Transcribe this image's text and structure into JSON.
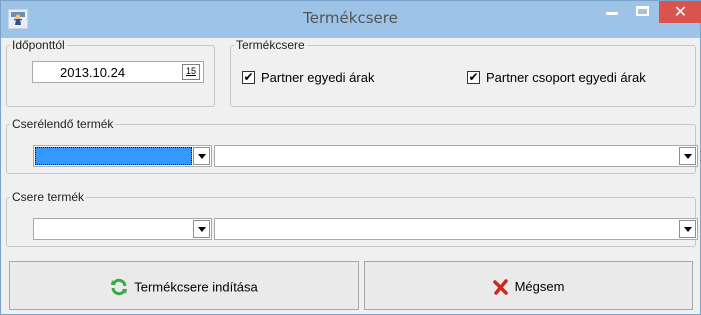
{
  "window": {
    "title": "Termékcsere"
  },
  "date_group": {
    "label": "Időponttól",
    "value": "2013.10.24",
    "calendar_glyph": "15"
  },
  "exchange_group": {
    "label": "Termékcsere",
    "partner_prices": {
      "label": "Partner egyedi árak",
      "checked": true
    },
    "partner_group_prices": {
      "label": "Partner csoport egyedi árak",
      "checked": true
    }
  },
  "source_product": {
    "label": "Cserélendő termék",
    "code": "",
    "name": ""
  },
  "target_product": {
    "label": "Csere termék",
    "code": "",
    "name": ""
  },
  "actions": {
    "start_label": "Termékcsere indítása",
    "cancel_label": "Mégsem"
  },
  "icons": {
    "app": "user-figure-icon",
    "start": "refresh-icon",
    "cancel": "x-cross-icon"
  },
  "colors": {
    "title_bar": "#9dc3e6",
    "close_button": "#d9534f",
    "selection": "#3399ff",
    "refresh_green": "#3aa845",
    "cancel_red": "#d0281f"
  }
}
